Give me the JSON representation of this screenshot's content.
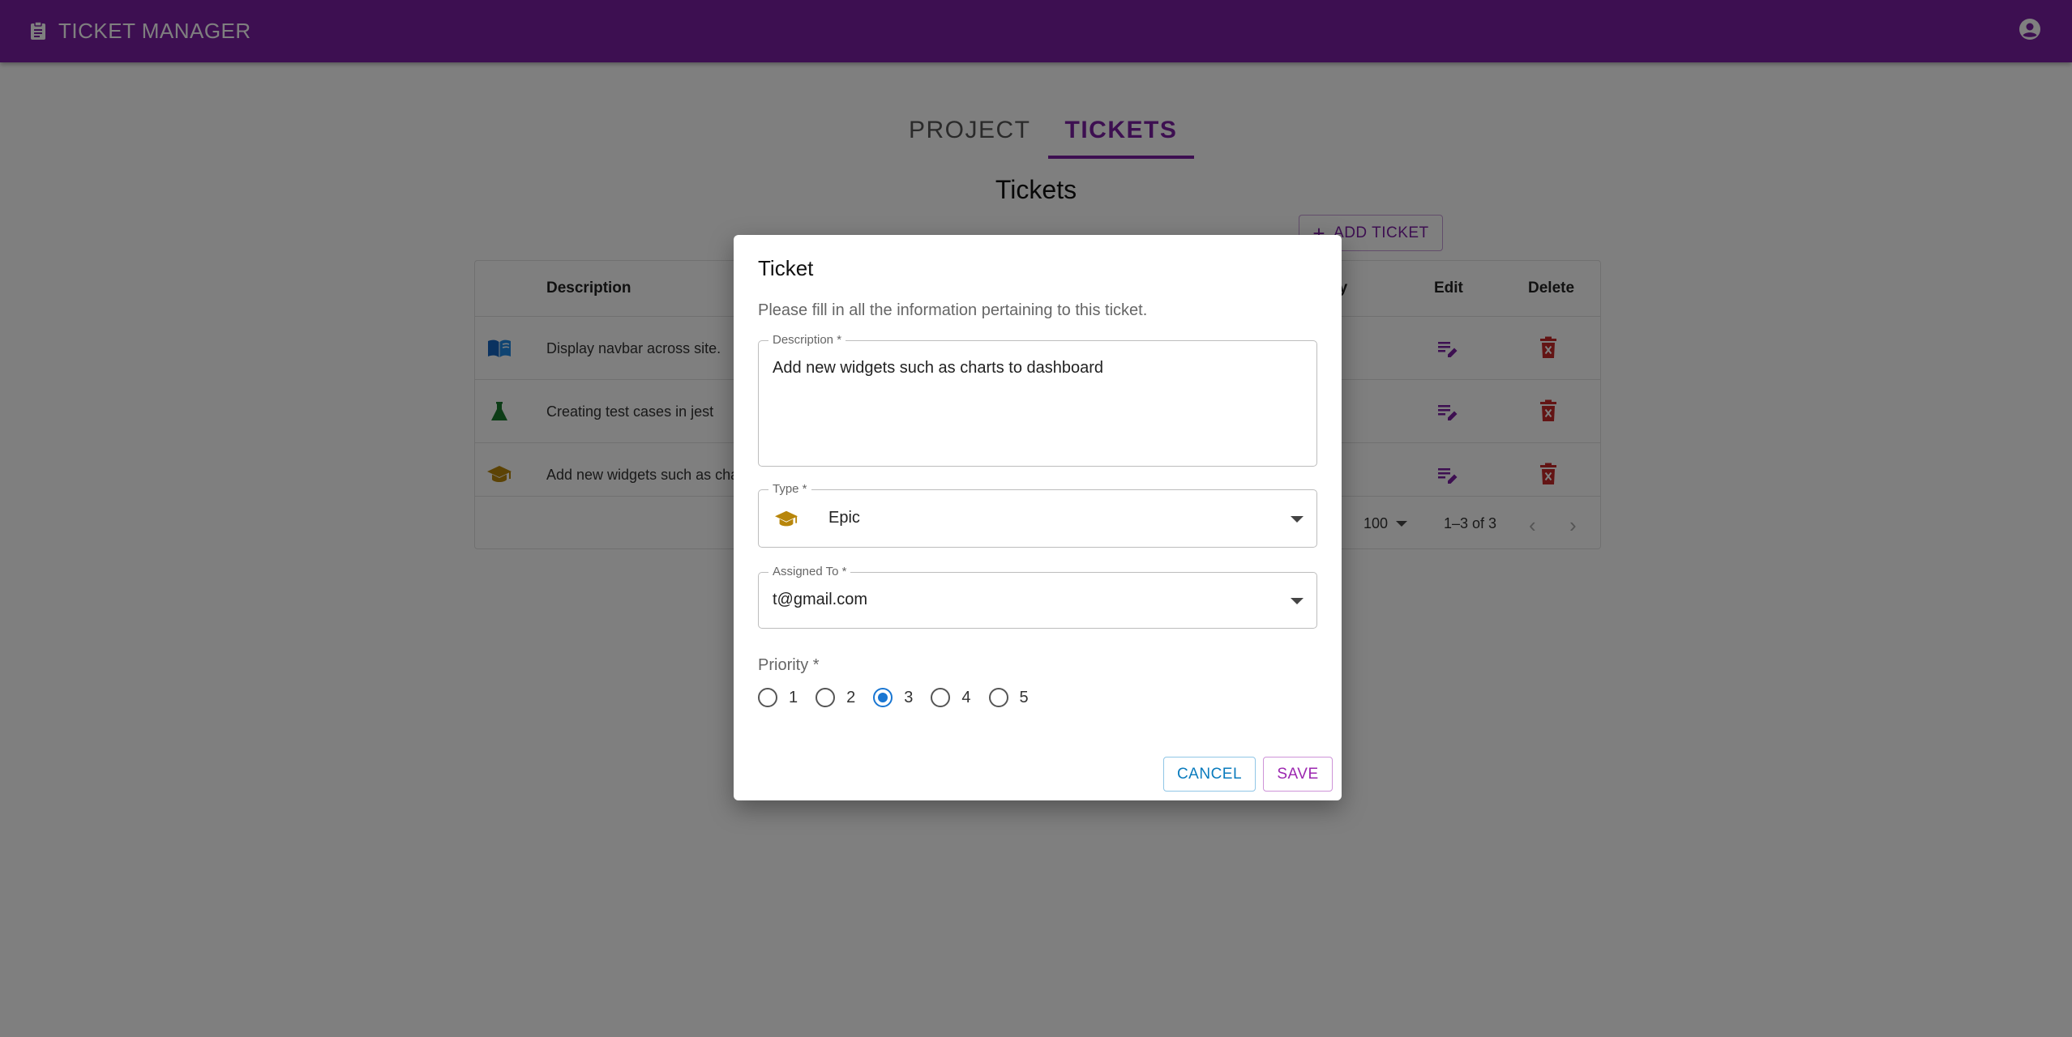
{
  "app": {
    "title": "TICKET MANAGER",
    "brand_color": "#7b1fa2",
    "brand_icon": "clipboard-icon",
    "account_icon": "account-circle-icon"
  },
  "tabs": [
    {
      "label": "PROJECT",
      "active": false
    },
    {
      "label": "TICKETS",
      "active": true
    }
  ],
  "section_title": "Tickets",
  "add_ticket_label": "ADD TICKET",
  "table": {
    "columns": {
      "description": "Description",
      "priority": "ity",
      "edit": "Edit",
      "delete": "Delete"
    },
    "rows": [
      {
        "type_icon": "story-book-icon",
        "description": "Display navbar across site."
      },
      {
        "type_icon": "test-flask-icon",
        "description": "Creating test cases in jest"
      },
      {
        "type_icon": "epic-graduation-cap-icon",
        "description": "Add new widgets such as charts to dashboard"
      }
    ],
    "pagination": {
      "rows_per_page_label": ":",
      "rows_per_page": "100",
      "range": "1–3 of 3"
    }
  },
  "dialog": {
    "title": "Ticket",
    "subtitle": "Please fill in all the information pertaining to this ticket.",
    "description": {
      "label": "Description *",
      "value": "Add new widgets such as charts to dashboard"
    },
    "type": {
      "label": "Type *",
      "value": "Epic",
      "icon": "epic-graduation-cap-icon"
    },
    "assigned_to": {
      "label": "Assigned To *",
      "value": "t@gmail.com"
    },
    "priority": {
      "label": "Priority *",
      "options": [
        "1",
        "2",
        "3",
        "4",
        "5"
      ],
      "selected": "3"
    },
    "cancel_label": "CANCEL",
    "save_label": "SAVE"
  }
}
